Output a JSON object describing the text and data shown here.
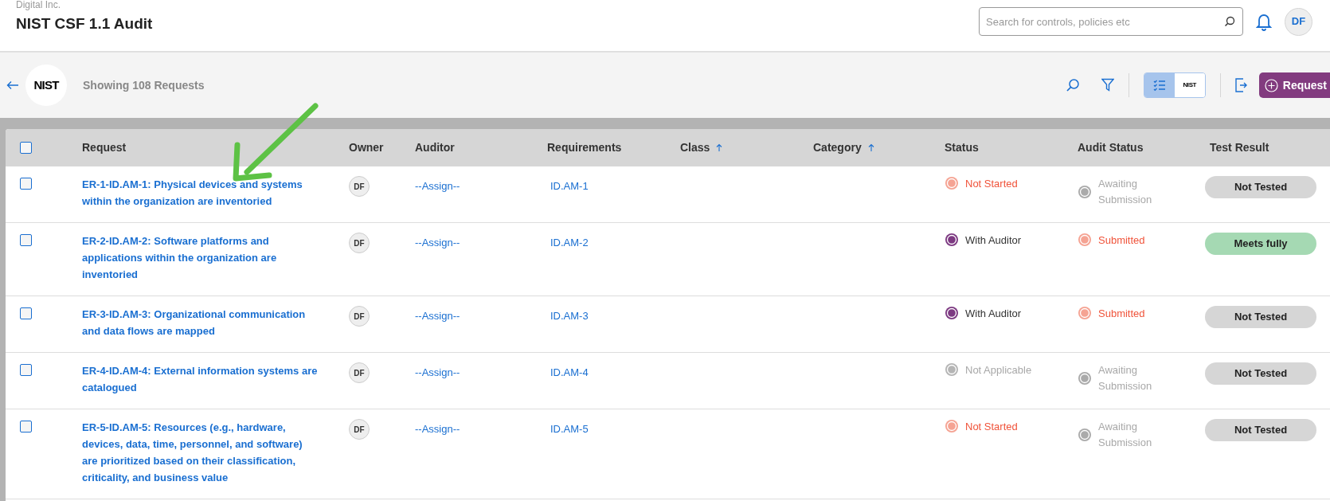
{
  "header": {
    "org": "Digital Inc.",
    "title": "NIST CSF 1.1 Audit",
    "search": {
      "placeholder": "Search for controls, policies etc"
    },
    "avatar": "DF"
  },
  "toolbar": {
    "logo_text": "NIST",
    "summary": "Showing 108 Requests",
    "views": [
      {
        "kind": "list",
        "selected": true
      },
      {
        "kind": "logo",
        "label": "NIST",
        "selected": false
      }
    ],
    "button": "Request"
  },
  "table": {
    "columns": [
      {
        "label": "Request",
        "sorted": false
      },
      {
        "label": "Owner",
        "sorted": false
      },
      {
        "label": "Auditor",
        "sorted": false
      },
      {
        "label": "Requirements",
        "sorted": false
      },
      {
        "label": "Class",
        "sorted": true
      },
      {
        "label": "Category",
        "sorted": true
      },
      {
        "label": "Status",
        "sorted": false
      },
      {
        "label": "Audit Status",
        "sorted": false
      },
      {
        "label": "Test Result",
        "sorted": false
      }
    ],
    "header_checked": false,
    "rows": [
      {
        "checked": false,
        "request": "ER-1-ID.AM-1: Physical devices and systems within the organization are inventoried",
        "owner": "DF",
        "auditor": "--Assign--",
        "requirement": "ID.AM-1",
        "status": {
          "kind": "not_started",
          "label": "Not Started"
        },
        "audit_status": {
          "kind": "awaiting",
          "label": "Awaiting Submission"
        },
        "test_result": {
          "kind": "not_tested",
          "label": "Not Tested"
        }
      },
      {
        "checked": false,
        "request": "ER-2-ID.AM-2: Software platforms and applications within the organization are inventoried",
        "owner": "DF",
        "auditor": "--Assign--",
        "requirement": "ID.AM-2",
        "status": {
          "kind": "with_auditor",
          "label": "With Auditor"
        },
        "audit_status": {
          "kind": "submitted",
          "label": "Submitted"
        },
        "test_result": {
          "kind": "meets_fully",
          "label": "Meets fully"
        }
      },
      {
        "checked": false,
        "request": "ER-3-ID.AM-3: Organizational communication and data flows are mapped",
        "owner": "DF",
        "auditor": "--Assign--",
        "requirement": "ID.AM-3",
        "status": {
          "kind": "with_auditor",
          "label": "With Auditor"
        },
        "audit_status": {
          "kind": "submitted",
          "label": "Submitted"
        },
        "test_result": {
          "kind": "not_tested",
          "label": "Not Tested"
        }
      },
      {
        "checked": false,
        "request": "ER-4-ID.AM-4: External information systems are catalogued",
        "owner": "DF",
        "auditor": "--Assign--",
        "requirement": "ID.AM-4",
        "status": {
          "kind": "not_applicable",
          "label": "Not Applicable"
        },
        "audit_status": {
          "kind": "awaiting",
          "label": "Awaiting Submission"
        },
        "test_result": {
          "kind": "not_tested",
          "label": "Not Tested"
        }
      },
      {
        "checked": false,
        "request": "ER-5-ID.AM-5: Resources (e.g., hardware, devices, data, time, personnel, and software) are prioritized based on their classification, criticality, and business value",
        "owner": "DF",
        "auditor": "--Assign--",
        "requirement": "ID.AM-5",
        "status": {
          "kind": "not_started",
          "label": "Not Started"
        },
        "audit_status": {
          "kind": "awaiting",
          "label": "Awaiting Submission"
        },
        "test_result": {
          "kind": "not_tested",
          "label": "Not Tested"
        }
      }
    ]
  }
}
